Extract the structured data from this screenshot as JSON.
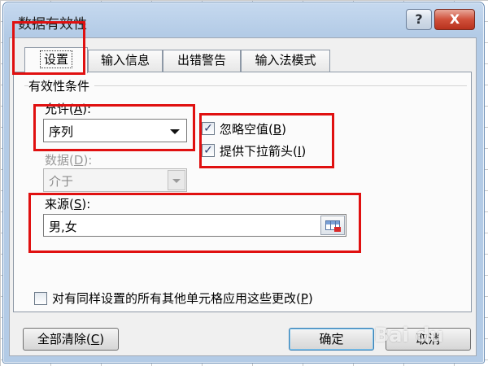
{
  "window": {
    "title": "数据有效性",
    "help_label": "?",
    "close_label": "X"
  },
  "tabs": [
    {
      "label": "设置",
      "active": true
    },
    {
      "label": "输入信息",
      "active": false
    },
    {
      "label": "出错警告",
      "active": false
    },
    {
      "label": "输入法模式",
      "active": false
    }
  ],
  "validation": {
    "group_label": "有效性条件",
    "allow_label": "允许",
    "allow_key": "A",
    "allow_value": "序列",
    "data_label": "数据",
    "data_key": "D",
    "data_value": "介于",
    "ignore_blank": {
      "label": "忽略空值",
      "key": "B",
      "checked": true
    },
    "in_cell_dropdown": {
      "label": "提供下拉箭头",
      "key": "I",
      "checked": true
    },
    "source_label": "来源",
    "source_key": "S",
    "source_value": "男,女",
    "apply_all": {
      "label": "对有同样设置的所有其他单元格应用这些更改",
      "key": "P",
      "checked": false
    }
  },
  "buttons": {
    "clear_all": "全部清除",
    "clear_key": "C",
    "ok": "确定",
    "cancel": "取消"
  },
  "watermark": "Bai du"
}
